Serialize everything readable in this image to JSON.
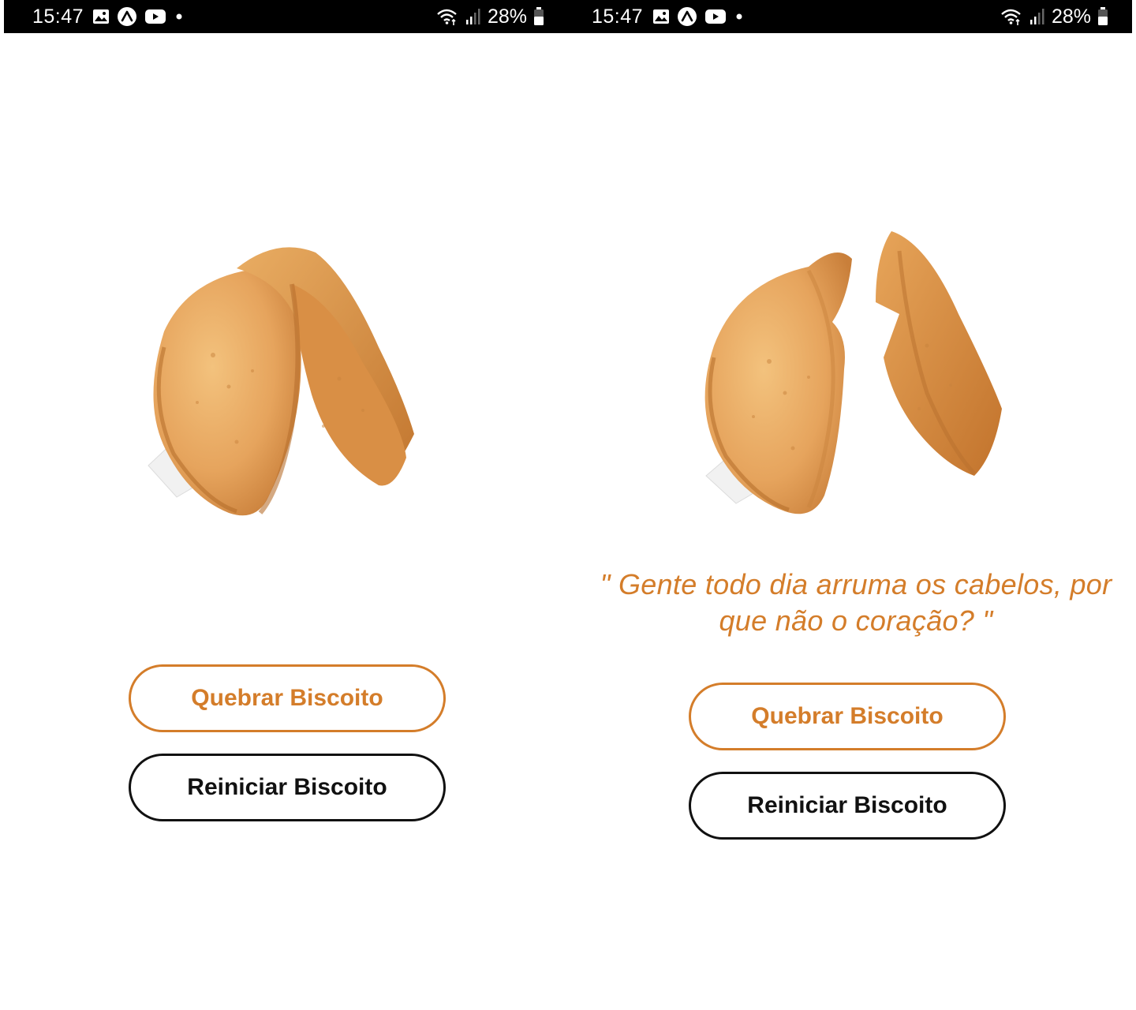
{
  "status_bar": {
    "time": "15:47",
    "battery": "28%",
    "icons_left": [
      "gallery-icon",
      "expo-icon",
      "youtube-icon",
      "dot-icon"
    ],
    "icons_right": [
      "wifi-icon",
      "signal-icon",
      "battery-icon"
    ]
  },
  "screens": [
    {
      "state": "whole",
      "cookie_icon": "fortune-cookie-whole",
      "quote": "",
      "buttons": {
        "break_label": "Quebrar Biscoito",
        "reset_label": "Reiniciar Biscoito"
      }
    },
    {
      "state": "broken",
      "cookie_icon": "fortune-cookie-broken",
      "quote": "\" Gente todo dia arruma os cabelos, por que não o coração? \"",
      "buttons": {
        "break_label": "Quebrar Biscoito",
        "reset_label": "Reiniciar Biscoito"
      }
    }
  ],
  "colors": {
    "accent": "#d47d2a",
    "reset_border": "#111111",
    "status_bar": "#000000",
    "background": "#ffffff"
  }
}
